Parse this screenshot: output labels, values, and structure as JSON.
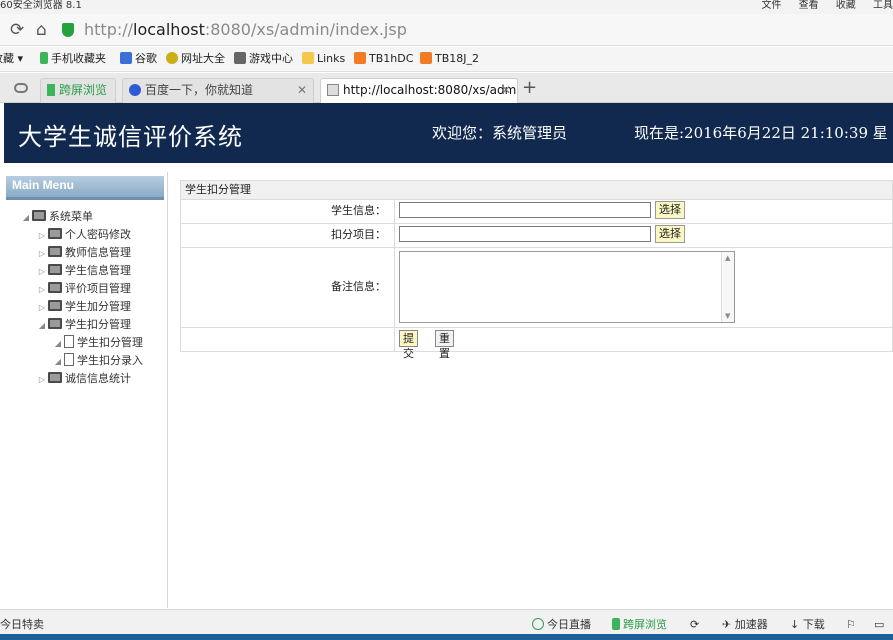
{
  "browser": {
    "title": "60安全浏览器 8.1",
    "top_menu": [
      "文件",
      "查看",
      "收藏",
      "工具"
    ],
    "url_prefix": "http://",
    "url_host": "localhost",
    "url_rest": ":8080/xs/admin/index.jsp",
    "bookmarks": [
      "收藏",
      "手机收藏夹",
      "谷歌",
      "网址大全",
      "游戏中心",
      "Links",
      "TB1hDC",
      "TB18J_2"
    ],
    "tabs": [
      {
        "label": "跨屏浏览",
        "active": false
      },
      {
        "label": "百度一下，你就知道",
        "active": false
      },
      {
        "label": "http://localhost:8080/xs/adm",
        "active": true
      }
    ],
    "status": {
      "left": "今日特卖",
      "items": [
        "今日直播",
        "跨屏浏览",
        "加速器",
        "下载"
      ]
    }
  },
  "header": {
    "system_title": "大学生诚信评价系统",
    "welcome": "欢迎您：系统管理员",
    "now": "现在是:2016年6月22日  21:10:39 星"
  },
  "sidebar": {
    "menu_title": "Main Menu",
    "root": "系统菜单",
    "items": [
      {
        "label": "个人密码修改"
      },
      {
        "label": "教师信息管理"
      },
      {
        "label": "学生信息管理"
      },
      {
        "label": "评价项目管理"
      },
      {
        "label": "学生加分管理"
      },
      {
        "label": "学生扣分管理"
      },
      {
        "label": "学生扣分管理"
      },
      {
        "label": "学生扣分录入"
      },
      {
        "label": "诚信信息统计"
      }
    ]
  },
  "form": {
    "page_title": "学生扣分管理",
    "student_label": "学生信息：",
    "student_value": "",
    "deduct_label": "扣分项目：",
    "deduct_value": "",
    "memo_label": "备注信息：",
    "memo_value": "",
    "select_label": "选择",
    "submit_label": "提交",
    "reset_label": "重置"
  }
}
